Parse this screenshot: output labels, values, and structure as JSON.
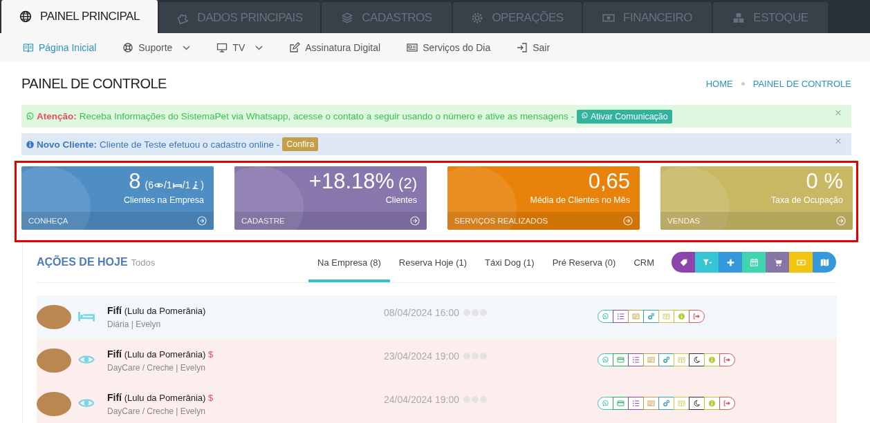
{
  "top_tabs": [
    {
      "label": "PAINEL PRINCIPAL",
      "kind": "globe",
      "selected": true
    },
    {
      "label": "DADOS PRINCIPAIS",
      "kind": "puzzle",
      "selected": false
    },
    {
      "label": "CADASTROS",
      "kind": "layers",
      "selected": false
    },
    {
      "label": "OPERAÇÕES",
      "kind": "gear",
      "selected": false
    },
    {
      "label": "FINANCEIRO",
      "kind": "money",
      "selected": false
    },
    {
      "label": "ESTOQUE",
      "kind": "cubes",
      "selected": false
    }
  ],
  "sub_nav": [
    {
      "label": "Página Inicial",
      "kind": "book",
      "dropdown": false,
      "selected": true
    },
    {
      "label": "Suporte",
      "kind": "lifebuoy",
      "dropdown": true,
      "selected": false
    },
    {
      "label": "TV",
      "kind": "monitor",
      "dropdown": true,
      "selected": false
    },
    {
      "label": "Assinatura Digital",
      "kind": "edit",
      "dropdown": false,
      "selected": false
    },
    {
      "label": "Serviços do Dia",
      "kind": "newspaper",
      "dropdown": false,
      "selected": false
    },
    {
      "label": "Sair",
      "kind": "signin",
      "dropdown": false,
      "selected": false
    }
  ],
  "page_title": "PAINEL DE CONTROLE",
  "breadcrumb": [
    "HOME",
    "PAINEL DE CONTROLE"
  ],
  "alerts": [
    {
      "kind": "success",
      "label": "Atenção:",
      "text": "Receba Informações do SistemaPet via Whatsapp, acesse o contato a seguir usando o número e ative as mensagens -",
      "button": "Ativar Comunicação",
      "close": "×"
    },
    {
      "kind": "info",
      "label": "Novo Cliente:",
      "text": "Cliente de Teste efetuou o cadastro online -",
      "button": "Confira",
      "close": "×"
    }
  ],
  "stat_cards": [
    {
      "color": "#4f8ec5",
      "value": "8",
      "breakdown": [
        {
          "kind": "eye",
          "count": "(6"
        },
        {
          "kind": "bed",
          "count": "/1"
        },
        {
          "kind": "walk",
          "count": "/1"
        }
      ],
      "breakdown_end": ")",
      "label": "Clientes na Empresa",
      "footer": "CONHEÇA"
    },
    {
      "color": "#8877ad",
      "value": "+18.18%",
      "extra": "(2)",
      "label": "Clientes",
      "footer": "CADASTRE"
    },
    {
      "color": "#e9820a",
      "value": "0,65",
      "label": "Média de Clientes no Mês",
      "footer": "SERVIÇOS REALIZADOS"
    },
    {
      "color": "#c8b864",
      "value": "0 %",
      "label": "Taxa de Ocupação",
      "footer": "VENDAS"
    }
  ],
  "actions": {
    "title": "AÇÕES DE HOJE",
    "subtitle": "Todos",
    "tabs": [
      {
        "label": "Na Empresa (8)",
        "selected": true
      },
      {
        "label": "Reserva Hoje (1)",
        "selected": false
      },
      {
        "label": "Táxi Dog (1)",
        "selected": false
      },
      {
        "label": "Pré Reserva (0)",
        "selected": false
      },
      {
        "label": "CRM",
        "selected": false
      }
    ],
    "toolbar": [
      {
        "kind": "tag",
        "color": "#8e44ad"
      },
      {
        "kind": "filter",
        "color": "#36c6d3"
      },
      {
        "kind": "plus",
        "color": "#3598dc"
      },
      {
        "kind": "calendar",
        "color": "#3fd5ae"
      },
      {
        "kind": "cart",
        "color": "#8775a7"
      },
      {
        "kind": "money",
        "color": "#f1c40f"
      },
      {
        "kind": "map",
        "color": "#3598dc"
      }
    ],
    "rows": [
      {
        "kind": "boarding",
        "name": "Fifí",
        "breed": "(Lulu da Pomerânia)",
        "details": "Diária | Evelyn",
        "datetime": "08/04/2024 16:00",
        "buttons": [
          {
            "kind": "whatsapp",
            "color": "#36c6a3"
          },
          {
            "kind": "list",
            "color": "#8e44ad"
          },
          {
            "kind": "card",
            "color": "#c49f47"
          },
          {
            "kind": "cogs",
            "color": "#36a3b3"
          },
          {
            "kind": "book",
            "color": "#c8c84a"
          },
          {
            "kind": "info",
            "color": "#b8c832"
          },
          {
            "kind": "exit",
            "color": "#e7505a"
          }
        ]
      },
      {
        "kind": "daycare",
        "name": "Fifí",
        "breed": "(Lulu da Pomerânia)",
        "charge": "$",
        "details": "DayCare / Creche | Evelyn",
        "datetime": "23/04/2024 19:00",
        "buttons": [
          {
            "kind": "whatsapp",
            "color": "#36c6a3"
          },
          {
            "kind": "payment",
            "color": "#27ae60"
          },
          {
            "kind": "list",
            "color": "#8e44ad"
          },
          {
            "kind": "card",
            "color": "#c49f47"
          },
          {
            "kind": "cogs",
            "color": "#36a3b3"
          },
          {
            "kind": "book",
            "color": "#c8c84a"
          },
          {
            "kind": "moon",
            "color": "#333333"
          },
          {
            "kind": "info",
            "color": "#b8c832"
          },
          {
            "kind": "exit",
            "color": "#e7505a"
          }
        ]
      },
      {
        "kind": "daycare",
        "name": "Fifí",
        "breed": "(Lulu da Pomerânia)",
        "charge": "$",
        "details": "DayCare / Creche | Evelyn",
        "datetime": "24/04/2024 19:00",
        "buttons": [
          {
            "kind": "whatsapp",
            "color": "#36c6a3"
          },
          {
            "kind": "payment",
            "color": "#27ae60"
          },
          {
            "kind": "list",
            "color": "#8e44ad"
          },
          {
            "kind": "card",
            "color": "#c49f47"
          },
          {
            "kind": "cogs",
            "color": "#36a3b3"
          },
          {
            "kind": "book",
            "color": "#c8c84a"
          },
          {
            "kind": "moon",
            "color": "#333333"
          },
          {
            "kind": "info",
            "color": "#b8c832"
          },
          {
            "kind": "exit",
            "color": "#e7505a"
          }
        ]
      }
    ]
  }
}
